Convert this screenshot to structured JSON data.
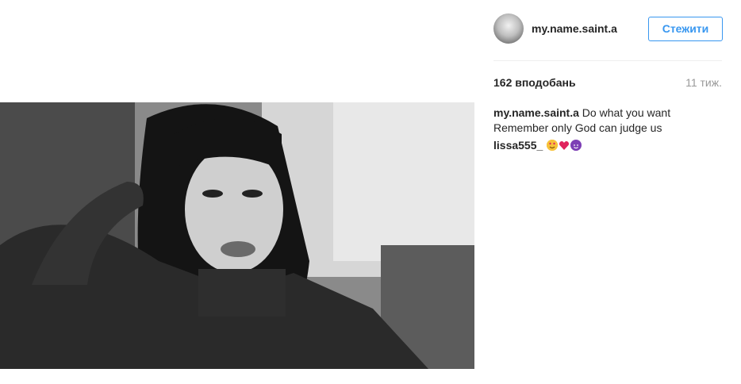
{
  "post": {
    "author": "my.name.saint.a",
    "follow_label": "Стежити",
    "likes": "162 вподобань",
    "time_ago": "11 тиж.",
    "caption_text": "Do what you want Remember only God can judge us"
  },
  "comments": [
    {
      "user": "lissa555_",
      "emojis": [
        "heart-eyes-emoji",
        "red-heart-emoji",
        "smiling-devil-emoji"
      ]
    }
  ],
  "colors": {
    "accent": "#3897f0",
    "text": "#262626",
    "muted": "#999999",
    "divider": "#efefef"
  }
}
